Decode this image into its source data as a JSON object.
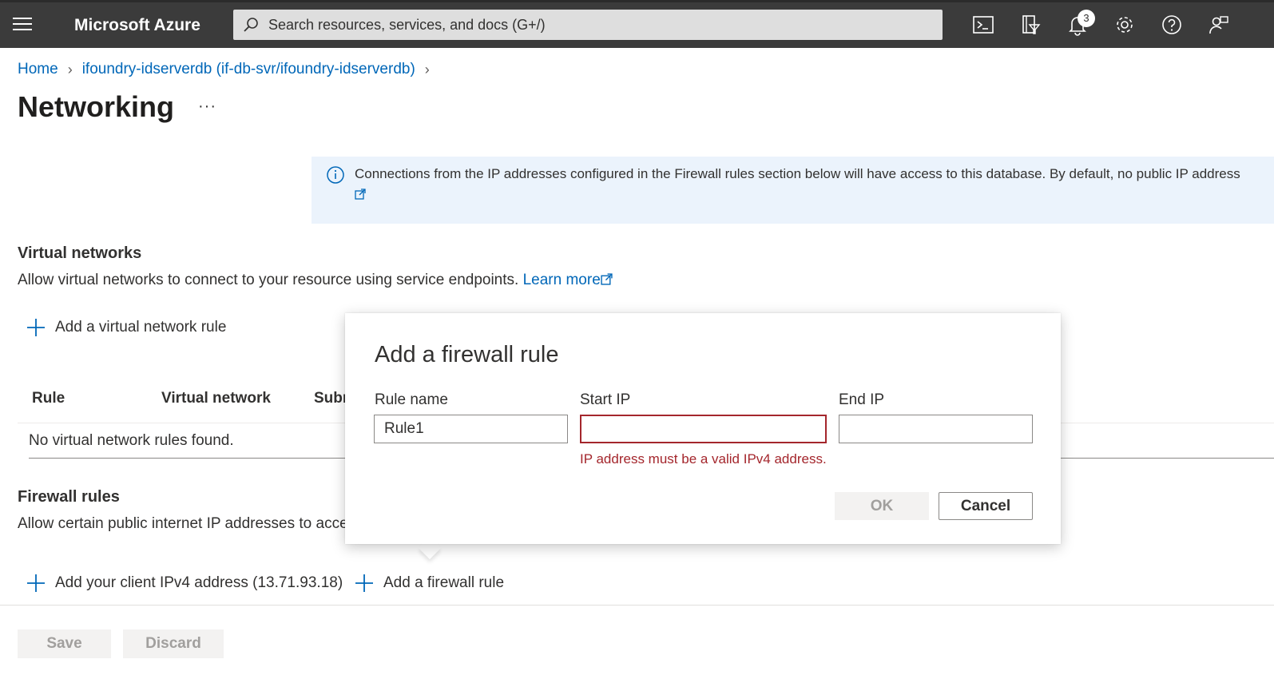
{
  "topbar": {
    "brand": "Microsoft Azure",
    "search_placeholder": "Search resources, services, and docs (G+/)",
    "notifications_count": "3",
    "icons": [
      "menu-icon",
      "search-icon",
      "cloud-shell-icon",
      "directory-filter-icon",
      "notifications-icon",
      "settings-icon",
      "help-icon",
      "feedback-icon"
    ]
  },
  "breadcrumb": {
    "home": "Home",
    "resource": "ifoundry-idserverdb (if-db-svr/ifoundry-idserverdb)"
  },
  "page": {
    "title": "Networking",
    "more": "···"
  },
  "info_banner": {
    "text": "Connections from the IP addresses configured in the Firewall rules section below will have access to this database. By default, no public IP address"
  },
  "virtual_networks": {
    "heading": "Virtual networks",
    "description": "Allow virtual networks to connect to your resource using service endpoints.",
    "learn_more": "Learn more",
    "add_rule": "Add a virtual network rule",
    "columns": [
      "Rule",
      "Virtual network",
      "Subn"
    ],
    "empty": "No virtual network rules found."
  },
  "firewall_rules": {
    "heading": "Firewall rules",
    "description": "Allow certain public internet IP addresses to acce",
    "add_client_ip": "Add your client IPv4 address (13.71.93.18)",
    "add_rule": "Add a firewall rule"
  },
  "footer": {
    "save": "Save",
    "discard": "Discard"
  },
  "dialog": {
    "title": "Add a firewall rule",
    "rule_name_label": "Rule name",
    "rule_name_value": "Rule1",
    "start_ip_label": "Start IP",
    "start_ip_value": "",
    "end_ip_label": "End IP",
    "end_ip_value": "",
    "error": "IP address must be a valid IPv4 address.",
    "ok": "OK",
    "cancel": "Cancel"
  },
  "colors": {
    "topbar": "#3b3b3b",
    "link": "#0067b8",
    "error": "#a4262c",
    "info_bg": "#ebf3fc"
  }
}
